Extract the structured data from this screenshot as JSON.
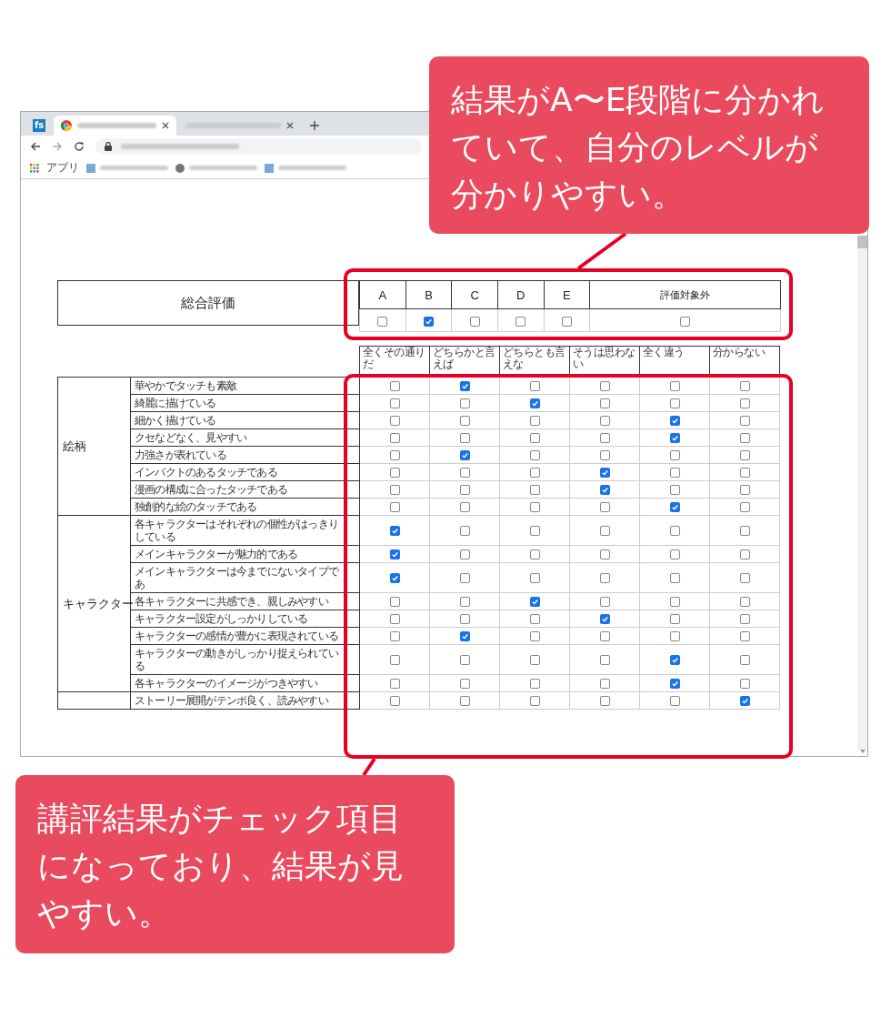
{
  "browser": {
    "tabs": [
      {
        "kind": "pinned",
        "label": "fs",
        "selected": false
      },
      {
        "kind": "page",
        "selected": true
      },
      {
        "kind": "page",
        "selected": false
      }
    ],
    "bookmarks": {
      "apps_label": "アプリ"
    }
  },
  "summary": {
    "title": "総合評価",
    "grades": [
      {
        "label": "A",
        "checked": false
      },
      {
        "label": "B",
        "checked": true
      },
      {
        "label": "C",
        "checked": false
      },
      {
        "label": "D",
        "checked": false
      },
      {
        "label": "E",
        "checked": false
      },
      {
        "label": "評価対象外",
        "checked": false
      }
    ]
  },
  "scale": {
    "labels": [
      "全くその通りだ",
      "どちらかと言えば",
      "どちらとも言えな",
      "そうは思わない",
      "全く違う",
      "分からない"
    ]
  },
  "groups": [
    {
      "name": "絵柄",
      "rows": [
        {
          "text": "華やかでタッチも素敵",
          "checked": [
            false,
            true,
            false,
            false,
            false,
            false
          ]
        },
        {
          "text": "綺麗に描けている",
          "checked": [
            false,
            false,
            true,
            false,
            false,
            false
          ]
        },
        {
          "text": "細かく描けている",
          "checked": [
            false,
            false,
            false,
            false,
            true,
            false
          ]
        },
        {
          "text": "クセなどなく、見やすい",
          "checked": [
            false,
            false,
            false,
            false,
            true,
            false
          ]
        },
        {
          "text": "力強さが表れている",
          "checked": [
            false,
            true,
            false,
            false,
            false,
            false
          ]
        },
        {
          "text": "インパクトのあるタッチである",
          "checked": [
            false,
            false,
            false,
            true,
            false,
            false
          ]
        },
        {
          "text": "漫画の構成に合ったタッチである",
          "checked": [
            false,
            false,
            false,
            true,
            false,
            false
          ]
        },
        {
          "text": "独創的な絵のタッチである",
          "checked": [
            false,
            false,
            false,
            false,
            true,
            false
          ]
        }
      ]
    },
    {
      "name": "キャラクター",
      "rows": [
        {
          "text": "各キャラクターはそれぞれの個性がはっきりしている",
          "checked": [
            true,
            false,
            false,
            false,
            false,
            false
          ]
        },
        {
          "text": "メインキャラクターが魅力的である",
          "checked": [
            true,
            false,
            false,
            false,
            false,
            false
          ]
        },
        {
          "text": "メインキャラクターは今までにないタイプであ",
          "checked": [
            true,
            false,
            false,
            false,
            false,
            false
          ]
        },
        {
          "text": "各キャラクターに共感でき、親しみやすい",
          "checked": [
            false,
            false,
            true,
            false,
            false,
            false
          ]
        },
        {
          "text": "キャラクター設定がしっかりしている",
          "checked": [
            false,
            false,
            false,
            true,
            false,
            false
          ]
        },
        {
          "text": "キャラクターの感情が豊かに表現されている",
          "checked": [
            false,
            true,
            false,
            false,
            false,
            false
          ]
        },
        {
          "text": "キャラクターの動きがしっかり捉えられている",
          "checked": [
            false,
            false,
            false,
            false,
            true,
            false
          ]
        },
        {
          "text": "各キャラクターのイメージがつきやすい",
          "checked": [
            false,
            false,
            false,
            false,
            true,
            false
          ]
        }
      ]
    },
    {
      "rows": [
        {
          "text": "ストーリー展開がテンポ良く、読みやすい",
          "checked": [
            false,
            false,
            false,
            false,
            false,
            true
          ]
        }
      ]
    }
  ],
  "callouts": [
    {
      "text": "結果がA〜E段階に分かれていて、自分のレベルが分かりやすい。"
    },
    {
      "text": "講評結果がチェック項目になっており、結果が見やすい。"
    }
  ]
}
